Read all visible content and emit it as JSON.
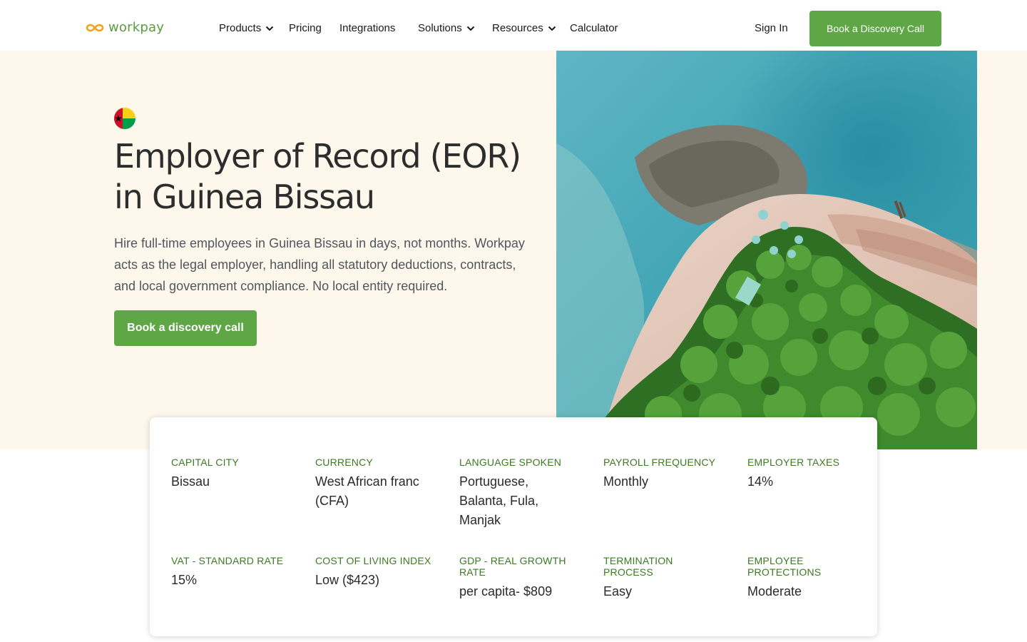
{
  "header": {
    "logo_text": "workpay",
    "nav": [
      {
        "label": "Products",
        "has_dropdown": true
      },
      {
        "label": "Pricing",
        "has_dropdown": false
      },
      {
        "label": "Integrations",
        "has_dropdown": false
      },
      {
        "label": "Solutions",
        "has_dropdown": true
      },
      {
        "label": "Resources",
        "has_dropdown": true
      },
      {
        "label": "Calculator",
        "has_dropdown": false
      }
    ],
    "sign_in": "Sign In",
    "cta": "Book a Discovery Call"
  },
  "hero": {
    "flag_icon": "guinea-bissau-flag-icon",
    "title": "Employer of Record (EOR) in Guinea Bissau",
    "description": "Hire full-time employees in Guinea Bissau in days, not months. Workpay acts as the legal employer, handling all statutory deductions, contracts, and local government compliance. No local entity required.",
    "cta": "Book a discovery call",
    "image_alt": "aerial-coastline-photo"
  },
  "facts": [
    {
      "label": "CAPITAL CITY",
      "value": "Bissau"
    },
    {
      "label": "CURRENCY",
      "value": "West African franc (CFA)"
    },
    {
      "label": "LANGUAGE SPOKEN",
      "value": "Portuguese, Balanta, Fula, Manjak"
    },
    {
      "label": "PAYROLL FREQUENCY",
      "value": "Monthly"
    },
    {
      "label": "EMPLOYER TAXES",
      "value": "14%"
    },
    {
      "label": "VAT - STANDARD RATE",
      "value": "15%"
    },
    {
      "label": "COST OF LIVING INDEX",
      "value": "Low ($423)"
    },
    {
      "label": "GDP - REAL GROWTH RATE",
      "value": "per capita- $809"
    },
    {
      "label": "TERMINATION PROCESS",
      "value": "Easy"
    },
    {
      "label": "EMPLOYEE PROTECTIONS",
      "value": "Moderate"
    }
  ],
  "colors": {
    "brand_green": "#5ea646",
    "label_green": "#3b7a23",
    "logo_orange": "#f4a21c",
    "hero_bg": "#fdf7ec"
  }
}
